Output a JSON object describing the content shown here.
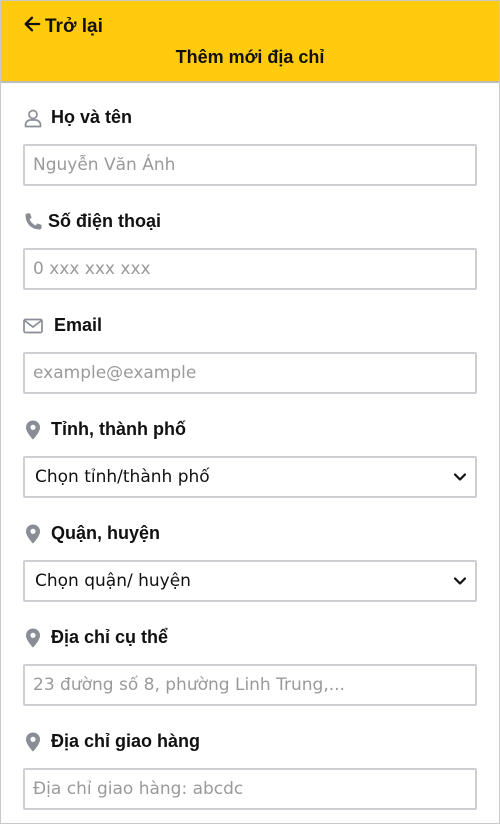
{
  "header": {
    "back_label": "Trở lại",
    "title": "Thêm mới địa chỉ"
  },
  "form": {
    "name": {
      "label": "Họ và tên",
      "placeholder": "Nguyễn Văn Ánh"
    },
    "phone": {
      "label": "Số điện thoại",
      "placeholder": "0 xxx xxx xxx"
    },
    "email": {
      "label": "Email",
      "placeholder": "example@example"
    },
    "province": {
      "label": "Tỉnh, thành phố",
      "selected": "Chọn tỉnh/thành phố"
    },
    "district": {
      "label": "Quận, huyện",
      "selected": "Chọn quận/ huyện"
    },
    "address": {
      "label": "Địa chỉ cụ thể",
      "placeholder": "23 đường số 8, phường Linh Trung,..."
    },
    "shipping": {
      "label": "Địa chỉ giao hàng",
      "placeholder": "Địa chỉ giao hàng: abcdc"
    }
  },
  "colors": {
    "header_bg": "#ffcb0c",
    "icon_gray": "#8a8d96"
  }
}
